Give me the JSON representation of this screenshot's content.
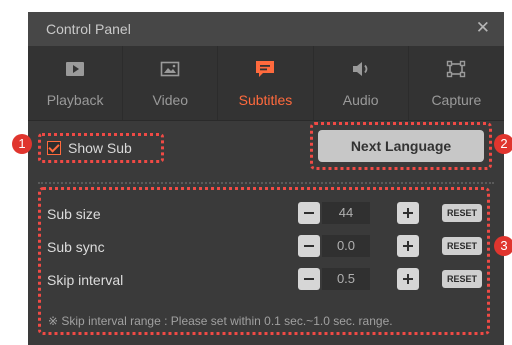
{
  "window": {
    "title": "Control Panel",
    "close_glyph": "✕"
  },
  "tabs": [
    {
      "label": "Playback",
      "icon": "playback-icon",
      "active": false
    },
    {
      "label": "Video",
      "icon": "video-icon",
      "active": false
    },
    {
      "label": "Subtitles",
      "icon": "subtitles-icon",
      "active": true
    },
    {
      "label": "Audio",
      "icon": "audio-icon",
      "active": false
    },
    {
      "label": "Capture",
      "icon": "capture-icon",
      "active": false
    }
  ],
  "subtitle_toggle": {
    "label": "Show Sub",
    "checked": true
  },
  "next_language": {
    "label": "Next Language"
  },
  "settings": [
    {
      "label": "Sub size",
      "value": "44",
      "reset": "RESET"
    },
    {
      "label": "Sub sync",
      "value": "0.0",
      "reset": "RESET"
    },
    {
      "label": "Skip interval",
      "value": "0.5",
      "reset": "RESET"
    }
  ],
  "note": "※ Skip interval range : Please set within 0.1 sec.~1.0 sec. range.",
  "badges": [
    "1",
    "2",
    "3"
  ],
  "colors": {
    "accent": "#ff6a3d",
    "highlight": "#f04a45",
    "badge": "#e0352e",
    "panel": "#3a3a3a"
  }
}
